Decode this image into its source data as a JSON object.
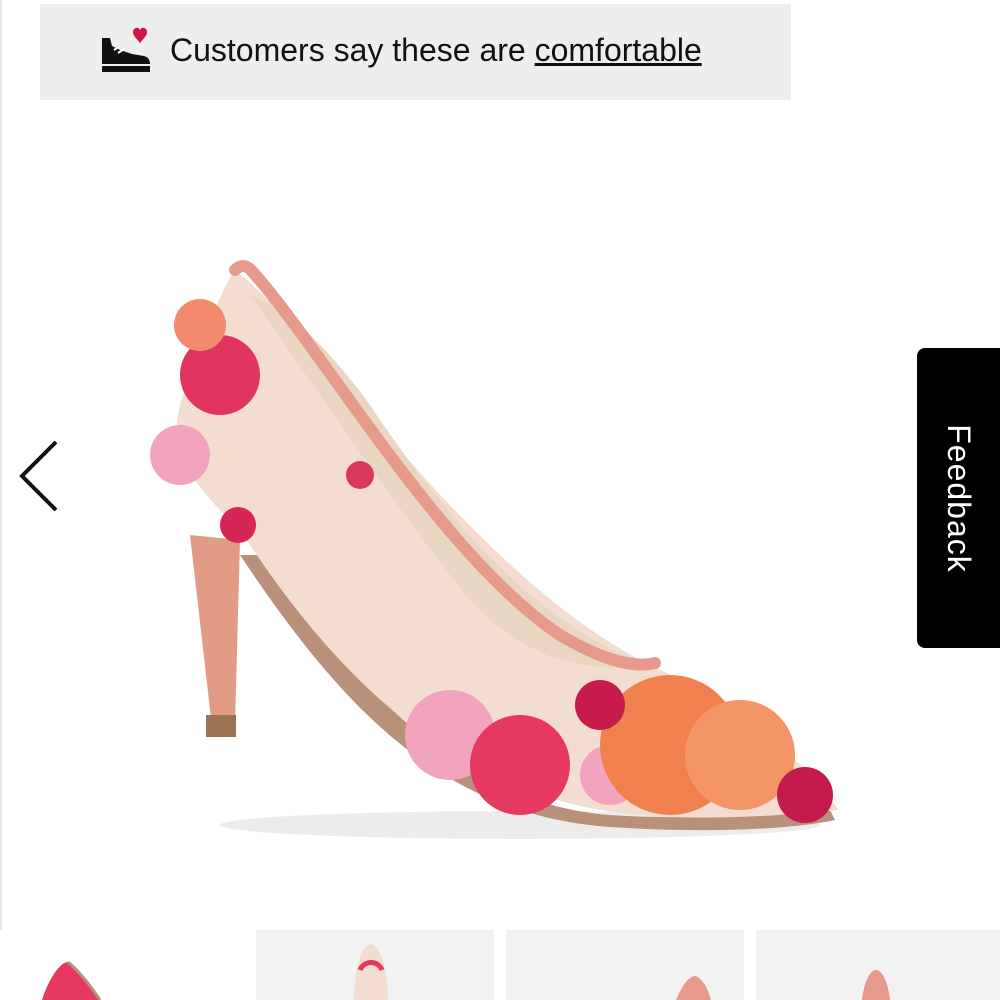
{
  "banner": {
    "text_prefix": "Customers say these are ",
    "link_text": "comfortable",
    "icon": "shoe-heart-icon"
  },
  "gallery": {
    "main_image": "floral embroidered mesh pointed-toe pump",
    "prev_icon": "chevron-left-icon"
  },
  "feedback": {
    "label": "Feedback"
  },
  "thumbnails": [
    {
      "name": "thumb-side-view"
    },
    {
      "name": "thumb-front-view"
    },
    {
      "name": "thumb-top-view"
    },
    {
      "name": "thumb-back-view"
    }
  ],
  "colors": {
    "banner_bg": "#eeeeee",
    "feedback_bg": "#000000",
    "trim_pink": "#e7998b",
    "heart_red": "#d0144a"
  }
}
